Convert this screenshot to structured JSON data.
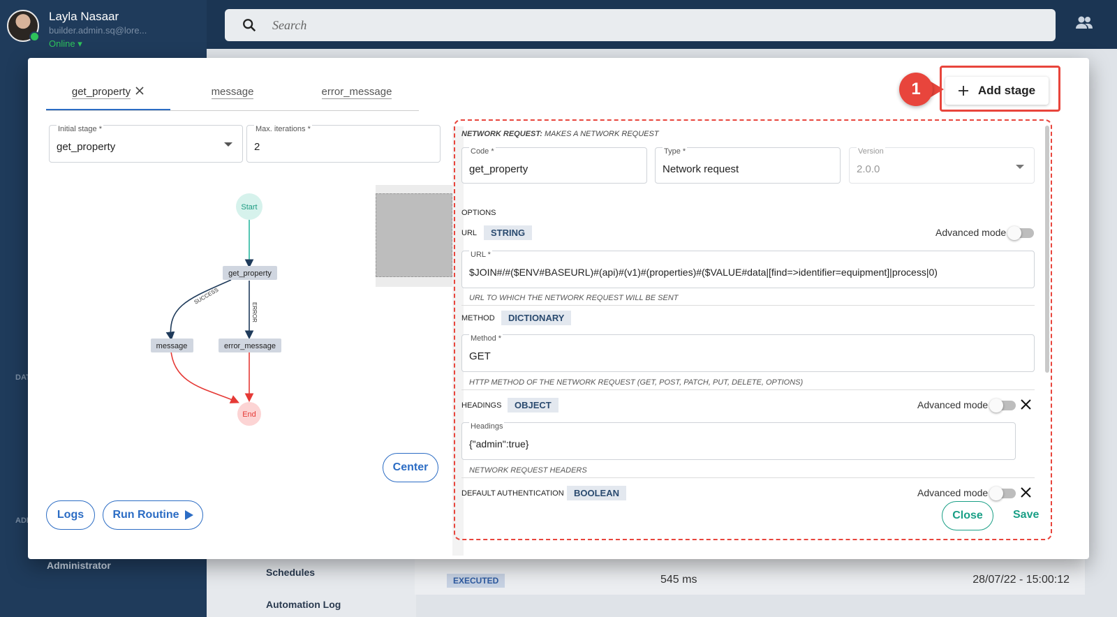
{
  "user": {
    "name": "Layla Nasaar",
    "email": "builder.admin.sq@lore...",
    "status": "Online"
  },
  "search": {
    "placeholder": "Search"
  },
  "sidebar": {
    "section_data": "DAT",
    "section_admin": "ADM",
    "admin_item": "Administrator"
  },
  "background": {
    "schedules": "Schedules",
    "automation_log": "Automation Log",
    "status_badge": "EXECUTED",
    "duration": "545 ms",
    "date": "28/07/22 - 15:00:12"
  },
  "modal": {
    "tabs": [
      {
        "label": "get_property"
      },
      {
        "label": "message"
      },
      {
        "label": "error_message"
      }
    ],
    "initial_stage": {
      "label": "Initial stage *",
      "value": "get_property"
    },
    "max_iterations": {
      "label": "Max. iterations *",
      "value": "2"
    },
    "graph": {
      "start": "Start",
      "end": "End",
      "nodes": [
        "get_property",
        "message",
        "error_message"
      ],
      "edge_success": "SUCCESS",
      "edge_error": "ERROR"
    },
    "buttons": {
      "center": "Center",
      "logs": "Logs",
      "run_routine": "Run Routine",
      "add_stage": "Add stage",
      "close": "Close",
      "save": "Save"
    },
    "annotation_number": "1",
    "panel": {
      "section_title": "NETWORK REQUEST:",
      "section_subtitle": "MAKES A NETWORK REQUEST",
      "code": {
        "label": "Code *",
        "value": "get_property"
      },
      "type": {
        "label": "Type *",
        "value": "Network request"
      },
      "version": {
        "label": "Version",
        "value": "2.0.0"
      },
      "options_label": "OPTIONS",
      "url": {
        "name": "URL",
        "type": "STRING",
        "advanced": "Advanced mode",
        "field_label": "URL *",
        "value": "$JOIN#/#($ENV#BASEURL)#(api)#(v1)#(properties)#($VALUE#data|[find=>identifier=equipment]|process|0)",
        "help": "URL TO WHICH THE NETWORK REQUEST WILL BE SENT"
      },
      "method": {
        "name": "METHOD",
        "type": "DICTIONARY",
        "field_label": "Method *",
        "value": "GET",
        "help": "HTTP METHOD OF THE NETWORK REQUEST (GET, POST, PATCH, PUT, DELETE, OPTIONS)"
      },
      "headings": {
        "name": "HEADINGS",
        "type": "OBJECT",
        "advanced": "Advanced mode",
        "field_label": "Headings",
        "value": "{\"admin\":true}",
        "help": "NETWORK REQUEST HEADERS"
      },
      "default_auth": {
        "name": "DEFAULT AUTHENTICATION",
        "type": "BOOLEAN",
        "advanced": "Advanced mode"
      }
    }
  },
  "colors": {
    "accent": "#2b6cc4",
    "annotation": "#e8453c",
    "success_edge": "#2ab8a0",
    "error_edge": "#e53935",
    "close_green": "#1a9f86"
  }
}
